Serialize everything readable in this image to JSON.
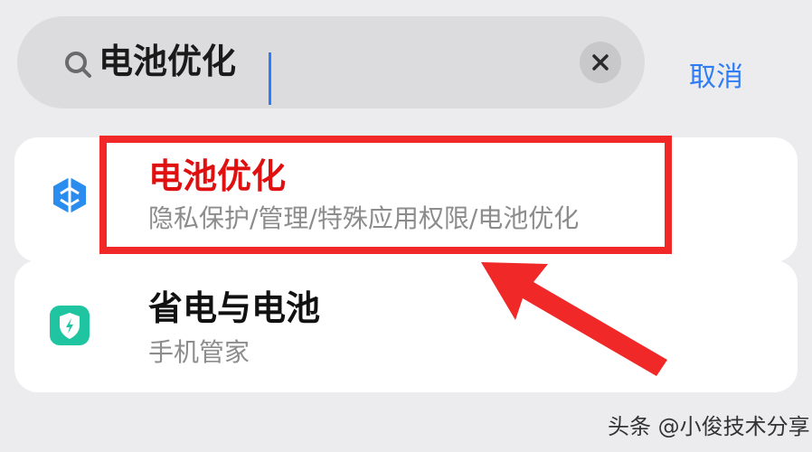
{
  "search": {
    "query": "电池优化",
    "cancel_label": "取消"
  },
  "results": [
    {
      "title": "电池优化",
      "path": "隐私保护/管理/特殊应用权限/电池优化",
      "icon": "privacy-shield-icon",
      "highlighted": true
    },
    {
      "title": "省电与电池",
      "path": "手机管家",
      "icon": "phone-manager-icon",
      "highlighted": false
    }
  ],
  "watermark": "头条 @小俊技术分享",
  "colors": {
    "accent": "#2f7df6",
    "highlight": "#f02828",
    "title_highlight": "#e01010",
    "manager_icon": "#1fc4a0"
  }
}
